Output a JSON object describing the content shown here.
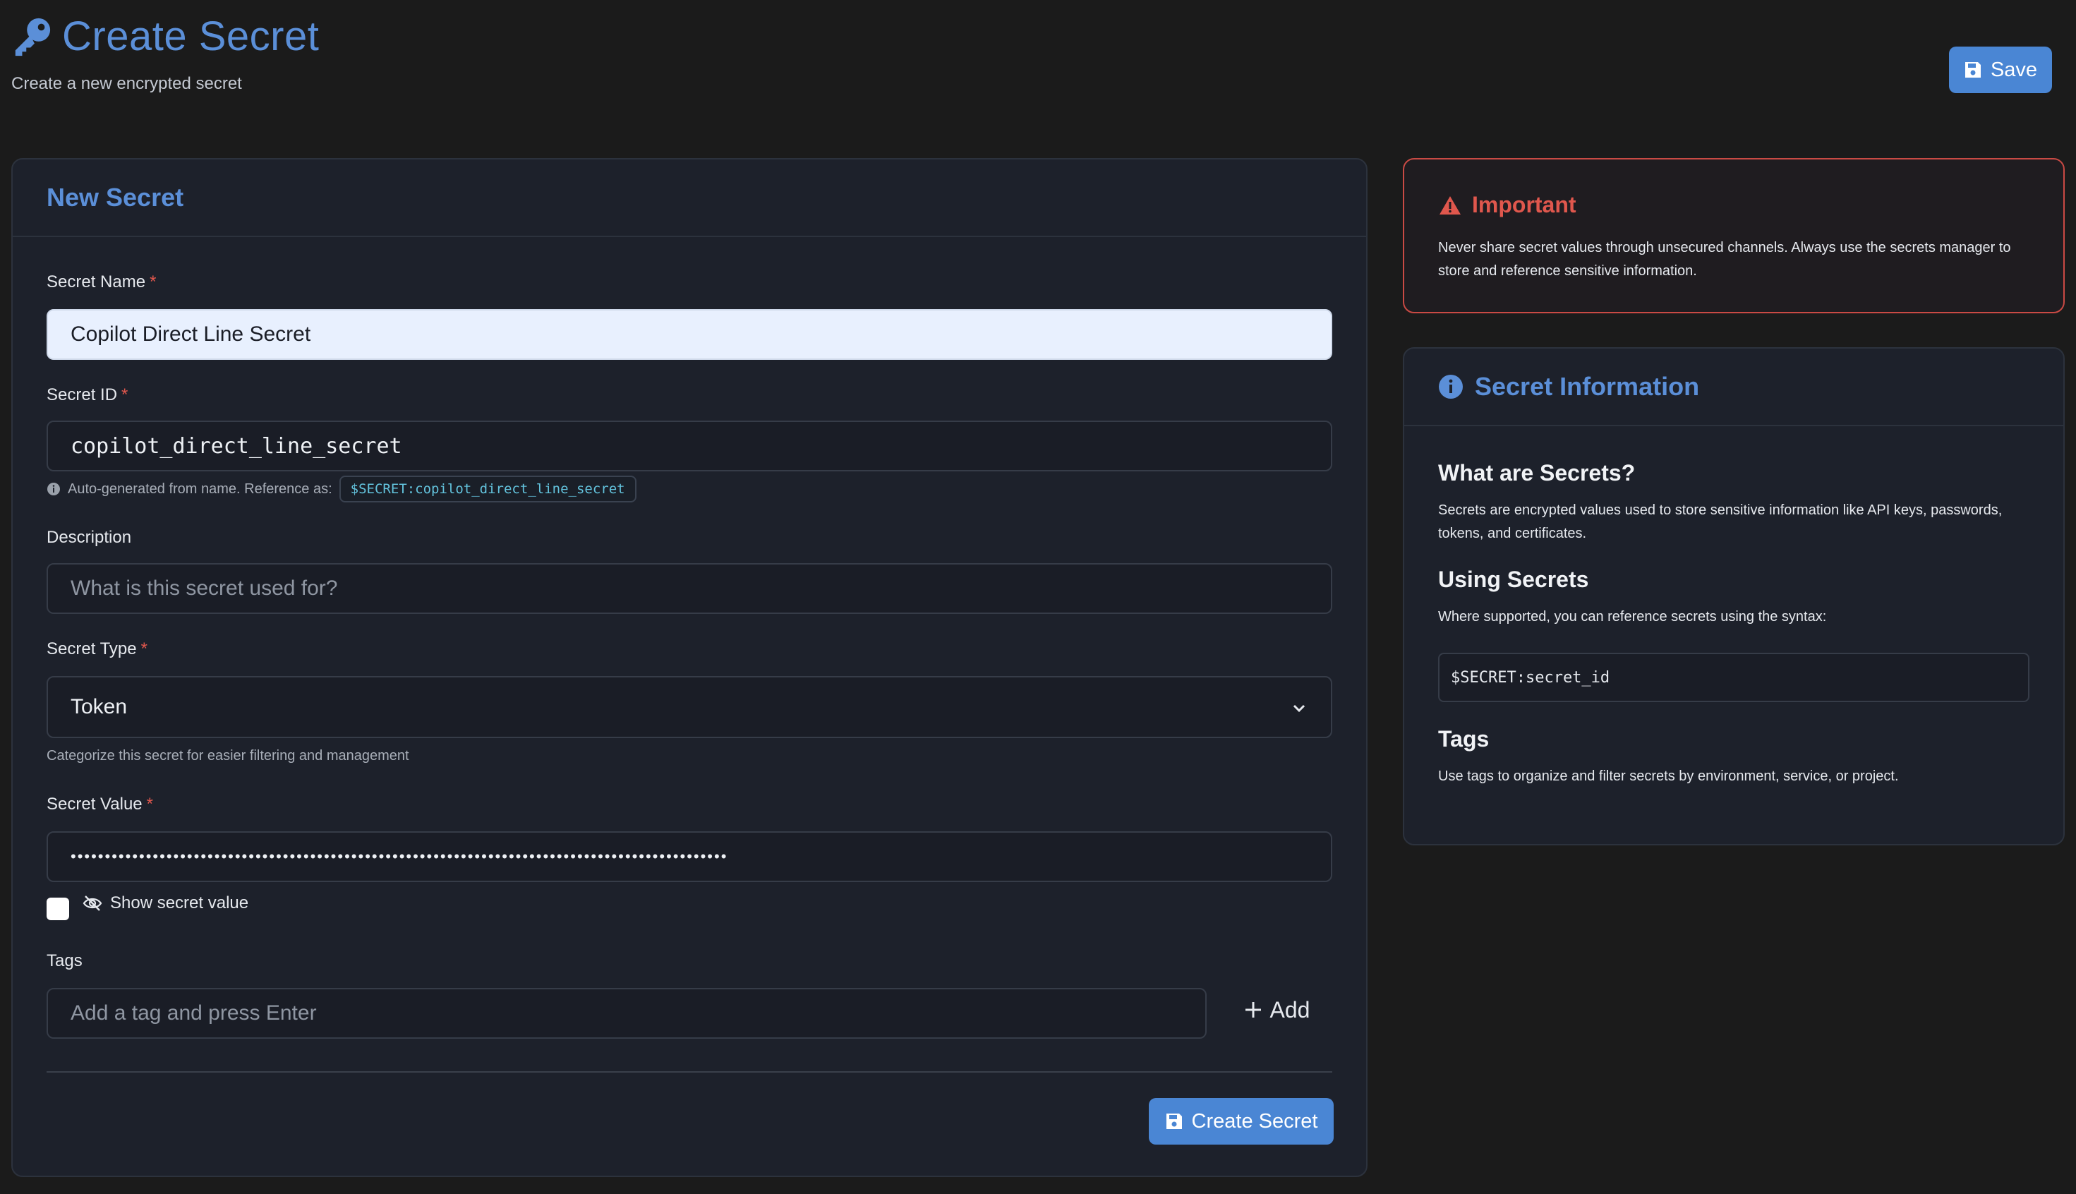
{
  "header": {
    "title": "Create Secret",
    "subtitle": "Create a new encrypted secret",
    "save_label": "Save"
  },
  "form": {
    "card_title": "New Secret",
    "name": {
      "label": "Secret Name",
      "required_mark": "*",
      "value": "Copilot Direct Line Secret"
    },
    "id": {
      "label": "Secret ID",
      "required_mark": "*",
      "value": "copilot_direct_line_secret",
      "hint": "Auto-generated from name. Reference as:",
      "reference": "$SECRET:copilot_direct_line_secret"
    },
    "description": {
      "label": "Description",
      "placeholder": "What is this secret used for?"
    },
    "type": {
      "label": "Secret Type",
      "required_mark": "*",
      "selected": "Token",
      "hint": "Categorize this secret for easier filtering and management"
    },
    "value": {
      "label": "Secret Value",
      "required_mark": "*",
      "masked": "••••••••••••••••••••••••••••••••••••••••••••••••••••••••••••••••••••••••••••••••••••••••••••••••",
      "show_label": "Show secret value"
    },
    "tags": {
      "label": "Tags",
      "placeholder": "Add a tag and press Enter",
      "add_label": "Add"
    },
    "submit_label": "Create Secret"
  },
  "important": {
    "title": "Important",
    "text": "Never share secret values through unsecured channels. Always use the secrets manager to store and reference sensitive information."
  },
  "info": {
    "title": "Secret Information",
    "what_heading": "What are Secrets?",
    "what_text": "Secrets are encrypted values used to store sensitive information like API keys, passwords, tokens, and certificates.",
    "using_heading": "Using Secrets",
    "using_text": "Where supported, you can reference secrets using the syntax:",
    "syntax": "$SECRET:secret_id",
    "tags_heading": "Tags",
    "tags_text": "Use tags to organize and filter secrets by environment, service, or project."
  },
  "colors": {
    "accent": "#5b8fd8",
    "button": "#4a86d4",
    "danger": "#e0574d",
    "background": "#1b1b1b"
  }
}
